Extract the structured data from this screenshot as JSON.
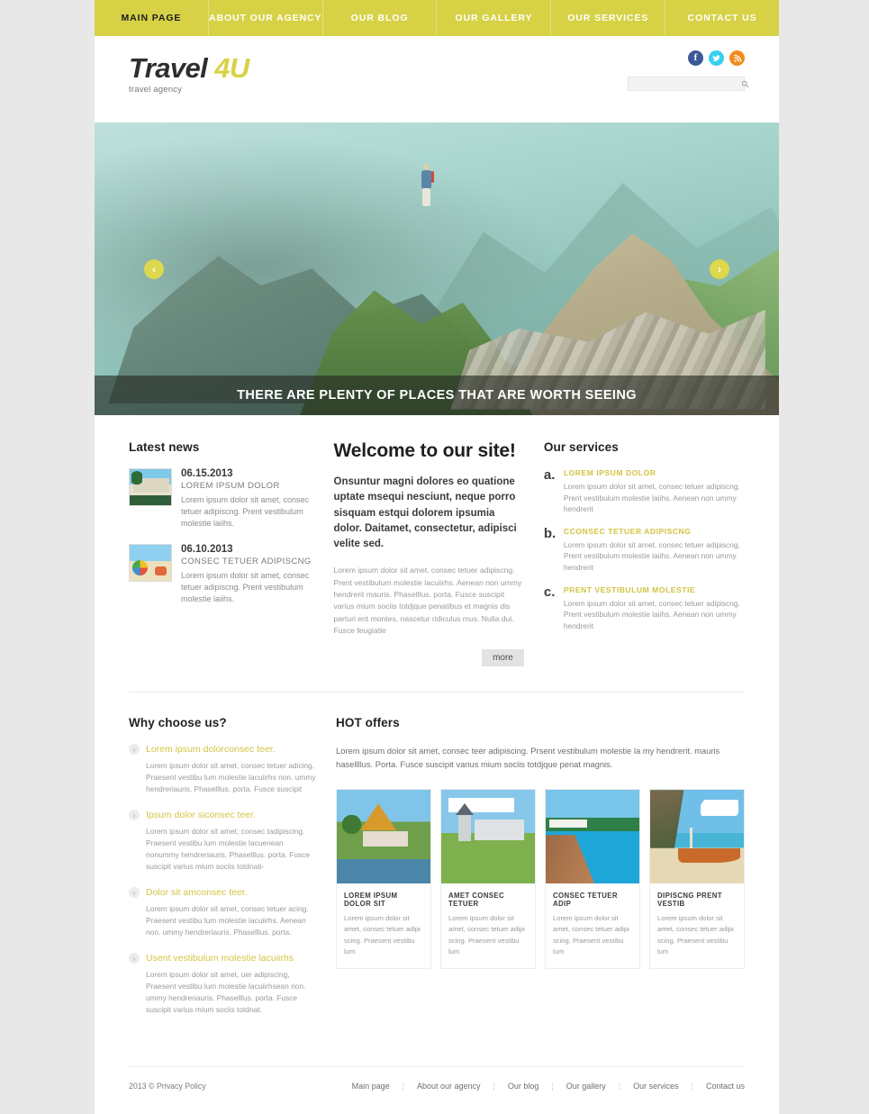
{
  "topnav": {
    "items": [
      {
        "label": "MAIN PAGE",
        "active": true
      },
      {
        "label": "ABOUT OUR AGENCY",
        "active": false
      },
      {
        "label": "OUR BLOG",
        "active": false
      },
      {
        "label": "OUR GALLERY",
        "active": false
      },
      {
        "label": "OUR SERVICES",
        "active": false
      },
      {
        "label": "CONTACT US",
        "active": false
      }
    ]
  },
  "header": {
    "logo_main": "Travel",
    "logo_accent": "4U",
    "logo_sub": "travel agency",
    "social": [
      {
        "name": "facebook",
        "glyph": "f",
        "color": "#3b5998"
      },
      {
        "name": "twitter",
        "glyph": "t",
        "color": "#38d0ef"
      },
      {
        "name": "rss",
        "glyph": "r",
        "color": "#f08c1e"
      }
    ],
    "search": {
      "value": "",
      "placeholder": "",
      "icon": "search-icon"
    }
  },
  "slider": {
    "caption": "THERE ARE PLENTY OF PLACES THAT ARE WORTH SEEING",
    "prev_label": "‹",
    "next_label": "›",
    "image_alt": "hiker walking a rocky mountain ridge trail in misty highlands"
  },
  "news": {
    "title": "Latest news",
    "items": [
      {
        "date": "06.15.2013",
        "subtitle": "LOREM IPSUM DOLOR",
        "text": "Lorem ipsum dolor sit amet, consec tetuer adipiscng. Prent vestibulum molestie laiihs.",
        "thumb": "resort-thumbnail"
      },
      {
        "date": "06.10.2013",
        "subtitle": "CONSEC TETUER ADIPISCNG",
        "text": "Lorem ipsum dolor sit amet, consec tetuer adipiscng. Prent vestibulum molestie laiihs.",
        "thumb": "beach-thumbnail"
      }
    ]
  },
  "welcome": {
    "title": "Welcome to our site!",
    "lead": "Onsuntur magni dolores eo quatione uptate msequi nesciunt, neque porro sisquam estqui dolorem ipsumia dolor. Daitamet, consectetur, adipisci velite sed.",
    "body": "Lorem ipsum dolor sit amet, consec tetuer adipiscng. Prent vestibulum molestie lacuiirhs. Aenean non ummy hendrerit mauris. Phaselllus. porta. Fusce suscipit varius mium sociis totdjque penatibus et magnis dis parturi ent montes, nascetur ridiculus mus. Nulla dui. Fusce feugiatle",
    "more_label": "more"
  },
  "services": {
    "title": "Our services",
    "items": [
      {
        "marker": "a.",
        "title": "LOREM IPSUM DOLOR",
        "text": "Lorem ipsum dolor sit amet, consec tetuer adipiscng. Prent vestibulum molestie laiihs. Aenean non ummy hendrerit"
      },
      {
        "marker": "b.",
        "title": "CCONSEC TETUER ADIPISCNG",
        "text": "Lorem ipsum dolor sit amet, consec tetuer adipiscng. Prent vestibulum molestie laiihs. Aenean non ummy hendrerit"
      },
      {
        "marker": "c.",
        "title": "PRENT VESTIBULUM MOLESTIE",
        "text": "Lorem ipsum dolor sit amet, consec tetuer adipiscng. Prent vestibulum molestie laiihs. Aenean non ummy hendrerit"
      }
    ]
  },
  "why": {
    "title": "Why choose us?",
    "bullet": "›",
    "items": [
      {
        "title": "Lorem ipsum dolorconsec teer.",
        "text": "Lorem ipsum dolor sit amet, consec tetuer adicing. Praesent vestibu lum molestie lacuiirhs non. ummy hendreriauris. Phaselllus. porta. Fusce suscipit"
      },
      {
        "title": "Ipsum dolor siconsec teer.",
        "text": "Lorem ipsum dolor sit amet, consec tadipiscing. Praesent vestibu lum molestie lacuenean nonummy hendreriauris. Phaselllus. porta. Fusce suscipit varius mium sociis totdnati-"
      },
      {
        "title": "Dolor sit amconsec teer.",
        "text": "Lorem ipsum dolor sit amet, consec tetuer acing. Praesent vestibu lum molestie lacuiirhs. Aenean non. ummy hendreriauris. Phaselllus. porta."
      },
      {
        "title": "Usent vestibulum molestie lacuiirhs",
        "text": "Lorem ipsum dolor sit amet, uer adipiscing, Praesent vestibu lum molestie lacuiirhsean non. ummy hendreriauris. Phaselllus. porta. Fusce suscipit varius mium sociis totdnat."
      }
    ]
  },
  "hot": {
    "title": "HOT offers",
    "lead": "Lorem ipsum dolor sit amet, consec teer adipiscing. Prsent vestibulum molestie la my hendrerit. mauris hasellllus.  Porta. Fusce suscipit varius mium sociis totdjque penat magnis.",
    "offers": [
      {
        "title": "LOREM IPSUM DOLOR SIT",
        "text": "Lorem ipsum dolor sit amet, consec tetuer adipi scing. Praesent vestibu lum",
        "image": "thai-temple-image"
      },
      {
        "title": "AMET CONSEC TETUER",
        "text": "Lorem ipsum dolor sit amet, consec tetuer adipi scing. Praesent vestibu lum",
        "image": "french-chateau-image"
      },
      {
        "title": "CONSEC TETUER ADIP",
        "text": "Lorem ipsum dolor sit amet, consec tetuer adipi scing. Praesent vestibu lum",
        "image": "resort-pool-image"
      },
      {
        "title": "DIPISCNG PRENT VESTIB",
        "text": "Lorem ipsum dolor sit amet, consec tetuer adipi scing. Praesent vestibu lum",
        "image": "longtail-boat-beach-image"
      }
    ]
  },
  "footer": {
    "copyright": "2013 © Privacy Policy",
    "links": [
      "Main page",
      "About our agency",
      "Our blog",
      "Our gallery",
      "Our services",
      "Contact us"
    ],
    "separator": "¦"
  },
  "colors": {
    "nav_yellow": "#d6d145",
    "accent_yellow": "#d5c545",
    "page_bg": "#e8e8e8",
    "text_dark": "#2e2e2e",
    "text_muted": "#9a9a9a"
  }
}
